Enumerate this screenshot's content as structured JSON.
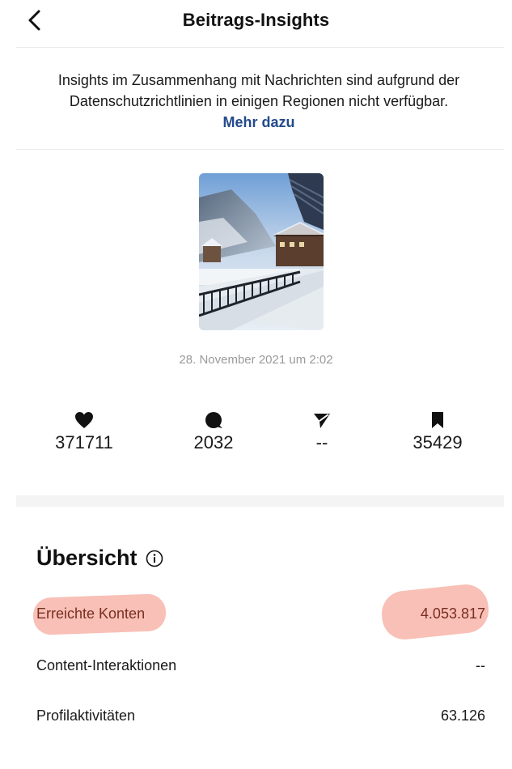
{
  "header": {
    "title": "Beitrags-Insights"
  },
  "notice": {
    "text": "Insights im Zusammenhang mit Nachrichten sind aufgrund der Datenschutzrichtlinien in einigen Regionen nicht verfügbar.",
    "link": "Mehr dazu"
  },
  "post": {
    "date": "28. November 2021 um 2:02"
  },
  "stats": [
    {
      "icon": "heart-icon",
      "value": "371711"
    },
    {
      "icon": "comment-icon",
      "value": "2032"
    },
    {
      "icon": "send-icon",
      "value": "--"
    },
    {
      "icon": "bookmark-icon",
      "value": "35429"
    }
  ],
  "overview": {
    "title": "Übersicht",
    "rows": [
      {
        "label": "Erreichte Konten",
        "value": "4.053.817"
      },
      {
        "label": "Content-Interaktionen",
        "value": "--"
      },
      {
        "label": "Profilaktivitäten",
        "value": "63.126"
      }
    ]
  },
  "colors": {
    "link": "#234a8c",
    "highlight": "#f28c7a"
  }
}
